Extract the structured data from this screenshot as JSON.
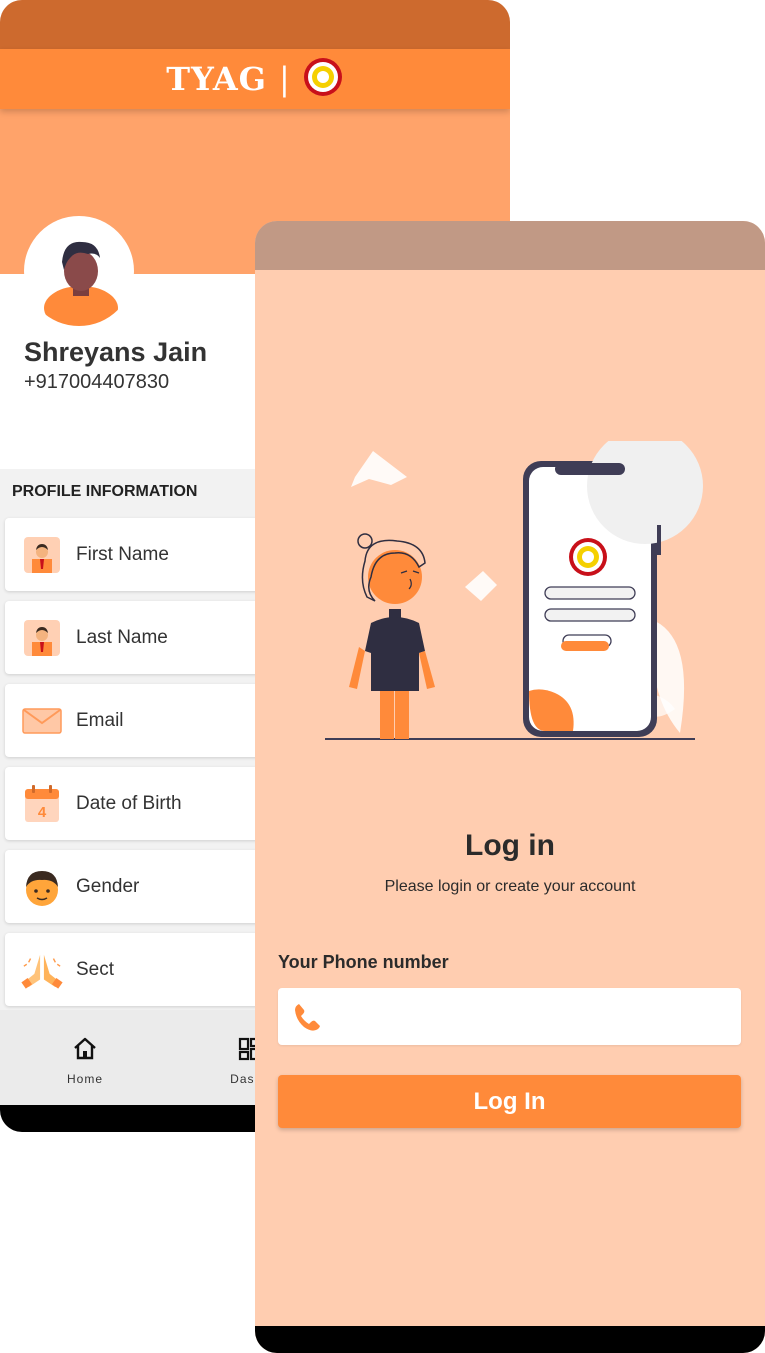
{
  "colors": {
    "brand_orange": "#ff8a3a",
    "status_bar_back": "#cd6a2e",
    "banner": "#ffa36a",
    "login_bg": "#ffcdb0",
    "status_bar_front": "#c19985"
  },
  "profile_screen": {
    "header": {
      "brand_text": "TYAG",
      "separator": "|",
      "logo_icon": "tyag-ring-logo-icon"
    },
    "user": {
      "name": "Shreyans Jain",
      "phone": "+917004407830",
      "avatar_icon": "user-avatar-icon"
    },
    "section_title": "PROFILE INFORMATION",
    "items": [
      {
        "label": "First Name",
        "icon": "person-icon"
      },
      {
        "label": "Last Name",
        "icon": "person-icon"
      },
      {
        "label": "Email",
        "icon": "envelope-icon"
      },
      {
        "label": "Date of Birth",
        "icon": "calendar-icon",
        "calendar_day": "4"
      },
      {
        "label": "Gender",
        "icon": "boy-face-icon"
      },
      {
        "label": "Sect",
        "icon": "folded-hands-icon"
      }
    ],
    "bottom_nav": [
      {
        "label": "Home",
        "icon": "home-icon"
      },
      {
        "label": "Dashb",
        "icon": "dashboard-icon"
      }
    ]
  },
  "login_screen": {
    "illustration": "person-with-phone-illustration",
    "title": "Log in",
    "subtitle": "Please login or create your account",
    "phone_label": "Your Phone number",
    "phone_input": {
      "value": "",
      "placeholder": "",
      "icon": "phone-icon"
    },
    "login_button": "Log In"
  }
}
